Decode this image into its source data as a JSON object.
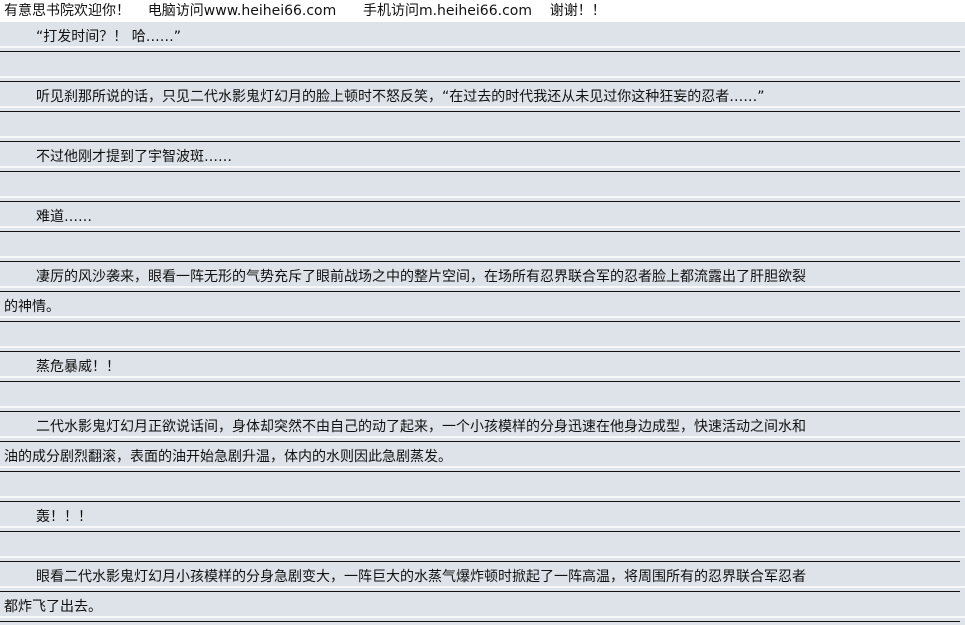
{
  "header": {
    "welcome": "有意思书院欢迎你！",
    "pc_visit": "电脑访问www.heihei66.com",
    "mobile_visit": "手机访问m.heihei66.com",
    "thanks": "谢谢！！"
  },
  "lines": [
    "“打发时间？！ 哈……”",
    "",
    "听见刹那所说的话，只见二代水影鬼灯幻月的脸上顿时不怒反笑，“在过去的时代我还从未见过你这种狂妄的忍者……”",
    "",
    "不过他刚才提到了宇智波斑……",
    "",
    "难道……",
    "",
    "凄厉的风沙袭来，眼看一阵无形的气势充斥了眼前战场之中的整片空间，在场所有忍界联合军的忍者脸上都流露出了肝胆欲裂",
    "的神情。",
    "",
    "蒸危暴威！！",
    "",
    "二代水影鬼灯幻月正欲说话间，身体却突然不由自己的动了起来，一个小孩模样的分身迅速在他身边成型，快速活动之间水和",
    "油的成分剧烈翻滚，表面的油开始急剧升温，体内的水则因此急剧蒸发。",
    "",
    "轰！！！",
    "",
    "眼看二代水影鬼灯幻月小孩模样的分身急剧变大，一阵巨大的水蒸气爆炸顿时掀起了一阵高温，将周围所有的忍界联合军忍者",
    "都炸飞了出去。"
  ]
}
